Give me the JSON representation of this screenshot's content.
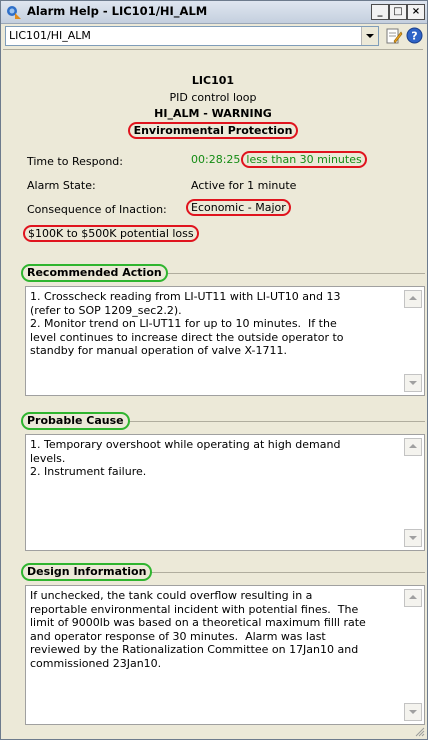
{
  "window": {
    "title": "Alarm Help - LIC101/HI_ALM",
    "minimize": "_",
    "maximize": "□",
    "close": "×"
  },
  "combo": {
    "value": "LIC101/HI_ALM"
  },
  "summary": {
    "tag": "LIC101",
    "description": "PID control loop",
    "alarm": "HI_ALM - WARNING",
    "category": "Environmental Protection",
    "time_label": "Time to Respond:",
    "time_value": "00:28:25",
    "time_note": "less than 30 minutes",
    "state_label": "Alarm State:",
    "state_value": "Active for 1 minute",
    "consequence_label": "Consequence of Inaction:",
    "consequence_value": "Economic - Major",
    "loss": "$100K to $500K potential loss"
  },
  "sections": {
    "recommended": {
      "title": "Recommended Action",
      "text": "1. Crosscheck reading from LI-UT11 with LI-UT10 and 13\n(refer to SOP 1209_sec2.2).\n2. Monitor trend on LI-UT11 for up to 10 minutes.  If the\nlevel continues to increase direct the outside operator to\nstandby for manual operation of valve X-1711."
    },
    "cause": {
      "title": "Probable Cause",
      "text": "1. Temporary overshoot while operating at high demand\nlevels.\n2. Instrument failure."
    },
    "design": {
      "title": "Design Information",
      "text": "If unchecked, the tank could overflow resulting in a\nreportable environmental incident with potential fines.  The\nlimit of 9000lb was based on a theoretical maximum filll rate\nand operator response of 30 minutes.  Alarm was last\nreviewed by the Rationalization Committee on 17Jan10 and\ncommissioned 23Jan10."
    }
  },
  "colors": {
    "highlight_red": "#e0141e",
    "highlight_green": "#2fb52f",
    "time_green": "#148c14"
  }
}
